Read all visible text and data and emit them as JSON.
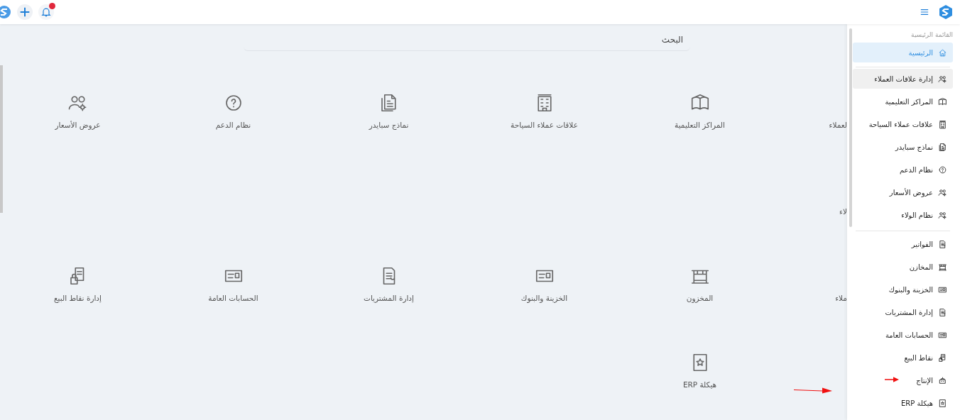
{
  "search": {
    "placeholder": "البحث"
  },
  "tile_rows": [
    {
      "edge_label": "لعملاء",
      "tiles": [
        {
          "label": "المراكز التعليمية",
          "kind": "board"
        },
        {
          "label": "علاقات عملاء السياحة",
          "kind": "building"
        },
        {
          "label": "نماذج سبايدر",
          "kind": "document"
        },
        {
          "label": "نظام الدعم",
          "kind": "question"
        },
        {
          "label": "عروض الأسعار",
          "kind": "users"
        }
      ]
    },
    {
      "edge_label": "لاء",
      "tiles": []
    },
    {
      "edge_label": "ملاء",
      "tiles": [
        {
          "label": "المخزون",
          "kind": "shelf"
        },
        {
          "label": "الخزينة والبنوك",
          "kind": "card"
        },
        {
          "label": "إدارة المشتريات",
          "kind": "invoice"
        },
        {
          "label": "الحسابات العامة",
          "kind": "card"
        },
        {
          "label": "إدارة نقاط البيع",
          "kind": "receipt"
        }
      ]
    },
    {
      "tiles": [
        {
          "label": "هيكلة ERP",
          "kind": "star-book"
        }
      ]
    }
  ],
  "sidebar": {
    "title": "القائمة الرئيسية",
    "groups": [
      [
        {
          "label": "الرئيسية",
          "kind": "home",
          "selected": true,
          "highlighted": false
        }
      ],
      [
        {
          "label": "إدارة علاقات العملاء",
          "kind": "users",
          "selected": false,
          "highlighted": true
        },
        {
          "label": "المراكز التعليمية",
          "kind": "board",
          "selected": false,
          "highlighted": false
        },
        {
          "label": "علاقات عملاء السياحة",
          "kind": "building",
          "selected": false,
          "highlighted": false
        },
        {
          "label": "نماذج سبايدر",
          "kind": "document",
          "selected": false,
          "highlighted": false
        },
        {
          "label": "نظام الدعم",
          "kind": "question",
          "selected": false,
          "highlighted": false
        },
        {
          "label": "عروض الأسعار",
          "kind": "users",
          "selected": false,
          "highlighted": false
        },
        {
          "label": "نظام الولاء",
          "kind": "users",
          "selected": false,
          "highlighted": false
        }
      ],
      [
        {
          "label": "الفواتير",
          "kind": "invoice",
          "selected": false,
          "highlighted": false
        },
        {
          "label": "المخازن",
          "kind": "shelf",
          "selected": false,
          "highlighted": false
        },
        {
          "label": "الخزينة والبنوك",
          "kind": "card",
          "selected": false,
          "highlighted": false
        },
        {
          "label": "إدارة المشتريات",
          "kind": "invoice",
          "selected": false,
          "highlighted": false
        },
        {
          "label": "الحسابات العامة",
          "kind": "card",
          "selected": false,
          "highlighted": false
        },
        {
          "label": "نقاط البيع",
          "kind": "receipt",
          "selected": false,
          "highlighted": false
        },
        {
          "label": "الإنتاج",
          "kind": "robot",
          "selected": false,
          "highlighted": false
        },
        {
          "label": "هيكلة ERP",
          "kind": "star-book",
          "selected": false,
          "highlighted": false
        }
      ]
    ]
  }
}
